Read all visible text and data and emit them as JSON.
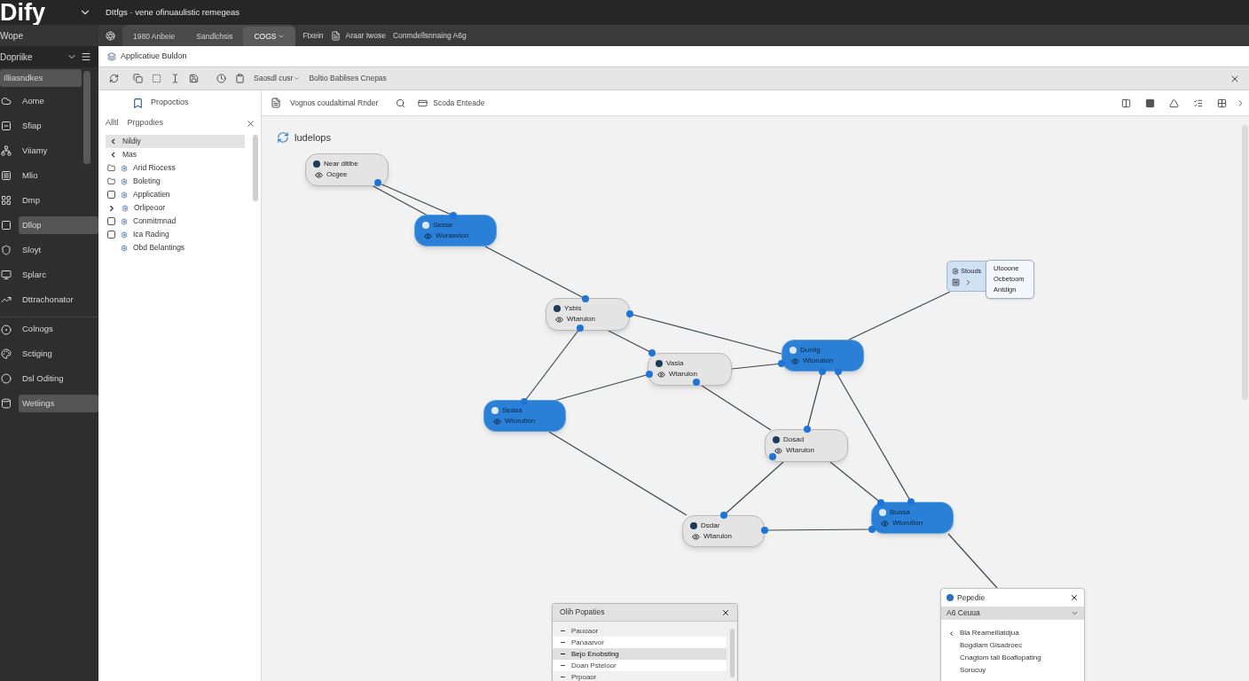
{
  "app": {
    "logo": "Dify",
    "title": "DItfgs · vene ofinuaulistic remegeas"
  },
  "sidebar": {
    "section": "Wope",
    "group": "Dopriike",
    "items": [
      {
        "label": "Illiasndkes",
        "selected": true
      },
      {
        "label": "Aome",
        "selected": false
      },
      {
        "label": "Sfiap",
        "selected": false
      },
      {
        "label": "Viiamy",
        "selected": false
      },
      {
        "label": "Mlio",
        "selected": false
      },
      {
        "label": "Dmp",
        "selected": false
      },
      {
        "label": "Dllop",
        "selected": true
      },
      {
        "label": "Sloyt",
        "selected": false
      },
      {
        "label": "Splarc",
        "selected": false
      },
      {
        "label": "Dttrachonator",
        "selected": false
      },
      {
        "label": "Colnogs",
        "selected": false
      },
      {
        "label": "Sctiging",
        "selected": false
      },
      {
        "label": "Dsl Oditing",
        "selected": false
      },
      {
        "label": "Wetiings",
        "selected": true
      }
    ]
  },
  "tabs": [
    {
      "label": "1980 Anbeie",
      "selected": false
    },
    {
      "label": "Sandlchsis",
      "selected": false
    },
    {
      "label": "COGS",
      "selected": true
    }
  ],
  "tab_links": [
    "Ftxein",
    "Araar Iwose",
    "Conmdellsnnaing A6g"
  ],
  "breadcrumb": "Applicatiue Buldon",
  "toolbar": {
    "menu": "Saosdl cusr",
    "label": "Boltio Bablises Cnepas"
  },
  "properties_panel": {
    "header": "Propoctios",
    "title_short": "Alltl",
    "title": "Prgpodies",
    "items": [
      {
        "kind": "back",
        "label": "Nildiy",
        "selected": true
      },
      {
        "kind": "back",
        "label": "Mas",
        "selected": false
      },
      {
        "kind": "folder",
        "label": "Arid Riocess",
        "selected": false
      },
      {
        "kind": "folder",
        "label": "Boleting",
        "selected": false
      },
      {
        "kind": "checkbox",
        "label": "Applicatien",
        "selected": false,
        "checked": false
      },
      {
        "kind": "expand",
        "label": "Orlipeoor",
        "selected": false
      },
      {
        "kind": "checkbox",
        "label": "Conmitmnad",
        "selected": false,
        "checked": false
      },
      {
        "kind": "checkbox",
        "label": "Ica Rading",
        "selected": false,
        "checked": false
      },
      {
        "kind": "plain",
        "label": "Obd Belantings",
        "selected": false
      }
    ]
  },
  "canvas": {
    "toolbar": [
      "Vognos coudaltimal Rnder",
      "Scoda Enteade"
    ],
    "title": "ludelops",
    "nodes": [
      {
        "title": "Near dltlbe",
        "subtitle": "Ocgee",
        "selected": false
      },
      {
        "title": "Sesse",
        "subtitle": "Wurasvion",
        "selected": true
      },
      {
        "title": "Ysbis",
        "subtitle": "Wtarulon",
        "selected": false
      },
      {
        "title": "Vasla",
        "subtitle": "Wtarulon",
        "selected": false
      },
      {
        "title": "Dunilg",
        "subtitle": "Wtorution",
        "selected": true
      },
      {
        "title": "Seasa",
        "subtitle": "Wtorution",
        "selected": true
      },
      {
        "title": "Dosad",
        "subtitle": "Wtarulon",
        "selected": false
      },
      {
        "title": "Dsdar",
        "subtitle": "Wtarulon",
        "selected": false
      },
      {
        "title": "Buasa",
        "subtitle": "Wtorution",
        "selected": true
      }
    ],
    "group_node": {
      "title": "Stouds",
      "menu": [
        "Utooone",
        "Ocbetoom",
        "Antdign"
      ]
    }
  },
  "bottom_panel": {
    "title": "Olih Popaties",
    "rows": [
      {
        "label": "Pauoaor",
        "selected": false
      },
      {
        "label": "Panaarvor",
        "selected": false
      },
      {
        "label": "Bejo Enobsting",
        "selected": true
      },
      {
        "label": "Doan Psteloor",
        "selected": false
      },
      {
        "label": "Prpoaor",
        "selected": false
      }
    ]
  },
  "side_panel": {
    "title": "Pepedie",
    "dropdown": "A6 Ceuua",
    "items": [
      "Bla Reameillatdjua",
      "Bogdiam Gisadroec",
      "Cnagtom tall Boaflopating",
      "Sorucuy"
    ]
  }
}
